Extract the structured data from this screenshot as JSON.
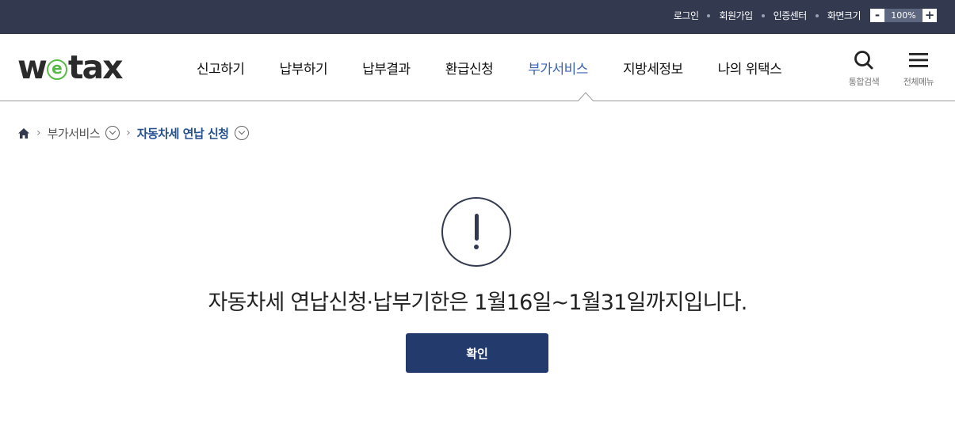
{
  "utility": {
    "login": "로그인",
    "signup": "회원가입",
    "cert_center": "인증센터",
    "zoom_label": "화면크기",
    "zoom_minus": "-",
    "zoom_value": "100%",
    "zoom_plus": "+"
  },
  "logo": {
    "pre": "w",
    "e": "e",
    "post": "tax"
  },
  "nav": {
    "items": [
      "신고하기",
      "납부하기",
      "납부결과",
      "환급신청",
      "부가서비스",
      "지방세정보",
      "나의 위택스"
    ],
    "active": "부가서비스"
  },
  "header_icons": {
    "search": "통합검색",
    "menu": "전체메뉴"
  },
  "breadcrumb": {
    "level1": "부가서비스",
    "level2": "자동차세 연납 신청"
  },
  "alert": {
    "message": "자동차세 연납신청·납부기한은 1월16일~1월31일까지입니다.",
    "confirm": "확인"
  },
  "colors": {
    "topbar": "#333a50",
    "active_nav": "#3b63b5",
    "button": "#233a6c",
    "logo_accent": "#58b947"
  },
  "icons": [
    "home-icon",
    "search-icon",
    "hamburger-menu-icon",
    "alert-exclamation-icon",
    "chevron-right-icon",
    "chevron-down-icon"
  ]
}
